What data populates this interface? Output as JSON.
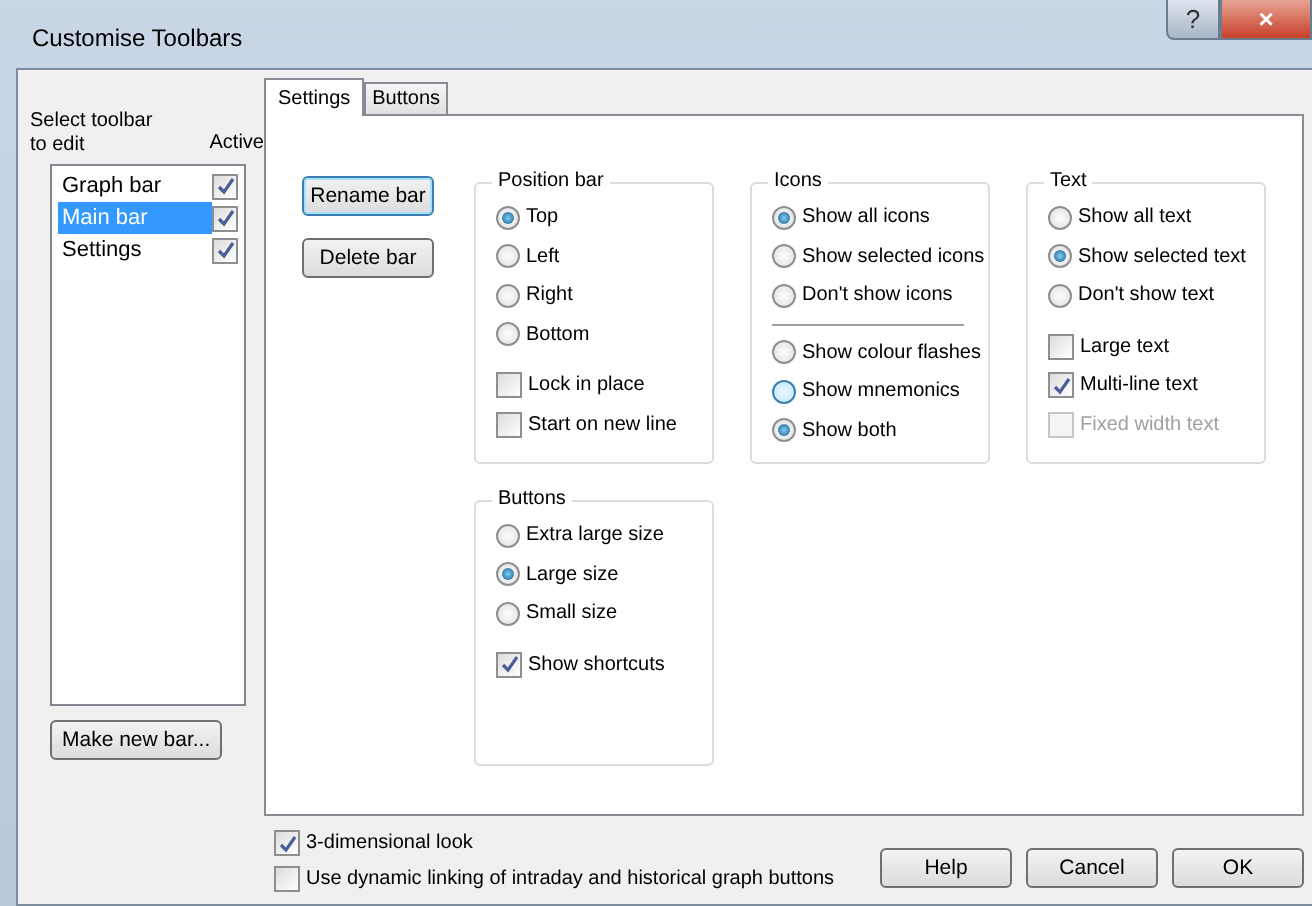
{
  "window": {
    "title": "Customise Toolbars",
    "title_buttons": [
      {
        "kind": "help",
        "label": "?"
      },
      {
        "kind": "close",
        "label": "×"
      }
    ]
  },
  "toolbar_list": {
    "label": "Select toolbar to edit",
    "active_label": "Active",
    "items": [
      {
        "name": "Graph bar",
        "selected": false,
        "active": true
      },
      {
        "name": "Main bar",
        "selected": true,
        "active": true
      },
      {
        "name": "Settings",
        "selected": false,
        "active": true
      }
    ]
  },
  "make_new_button": "Make new bar...",
  "tabs": [
    {
      "label": "Settings",
      "selected": true
    },
    {
      "label": "Buttons",
      "selected": false
    }
  ],
  "bar_buttons": [
    {
      "label": "Rename bar",
      "focused": true
    },
    {
      "label": "Delete bar",
      "focused": false
    }
  ],
  "groups": [
    {
      "title": "Position bar",
      "items": [
        {
          "kind": "radio",
          "label": "Top",
          "selected": true
        },
        {
          "kind": "radio",
          "label": "Left",
          "selected": false
        },
        {
          "kind": "radio",
          "label": "Right",
          "selected": false
        },
        {
          "kind": "radio",
          "label": "Bottom",
          "selected": false
        },
        {
          "kind": "checkbox",
          "label": "Lock in place",
          "checked": false,
          "disabled": false
        },
        {
          "kind": "checkbox",
          "label": "Start on new line",
          "checked": false,
          "disabled": false
        }
      ]
    },
    {
      "title": "Icons",
      "items": [
        {
          "kind": "radio",
          "label": "Show all icons",
          "selected": true
        },
        {
          "kind": "radio",
          "label": "Show selected icons",
          "selected": false
        },
        {
          "kind": "radio",
          "label": "Don't show icons",
          "selected": false
        },
        {
          "kind": "separator"
        },
        {
          "kind": "radio",
          "label": "Show colour flashes",
          "selected": false
        },
        {
          "kind": "radio",
          "label": "Show mnemonics",
          "selected": false,
          "hovered": true
        },
        {
          "kind": "radio",
          "label": "Show both",
          "selected": true
        }
      ]
    },
    {
      "title": "Text",
      "items": [
        {
          "kind": "radio",
          "label": "Show all text",
          "selected": false
        },
        {
          "kind": "radio",
          "label": "Show selected text",
          "selected": true
        },
        {
          "kind": "radio",
          "label": "Don't show text",
          "selected": false
        },
        {
          "kind": "checkbox",
          "label": "Large text",
          "checked": false,
          "disabled": false
        },
        {
          "kind": "checkbox",
          "label": "Multi-line text",
          "checked": true,
          "disabled": false
        },
        {
          "kind": "checkbox",
          "label": "Fixed width text",
          "checked": false,
          "disabled": true
        }
      ]
    },
    {
      "title": "Buttons",
      "items": [
        {
          "kind": "radio",
          "label": "Extra large size",
          "selected": false
        },
        {
          "kind": "radio",
          "label": "Large size",
          "selected": true
        },
        {
          "kind": "radio",
          "label": "Small size",
          "selected": false
        },
        {
          "kind": "checkbox",
          "label": "Show shortcuts",
          "checked": true,
          "disabled": false
        }
      ]
    }
  ],
  "options": [
    {
      "label": "3-dimensional look",
      "checked": true
    },
    {
      "label": "Use dynamic linking of intraday and historical graph buttons",
      "checked": false
    }
  ],
  "dialog_buttons": [
    "Help",
    "Cancel",
    "OK"
  ]
}
